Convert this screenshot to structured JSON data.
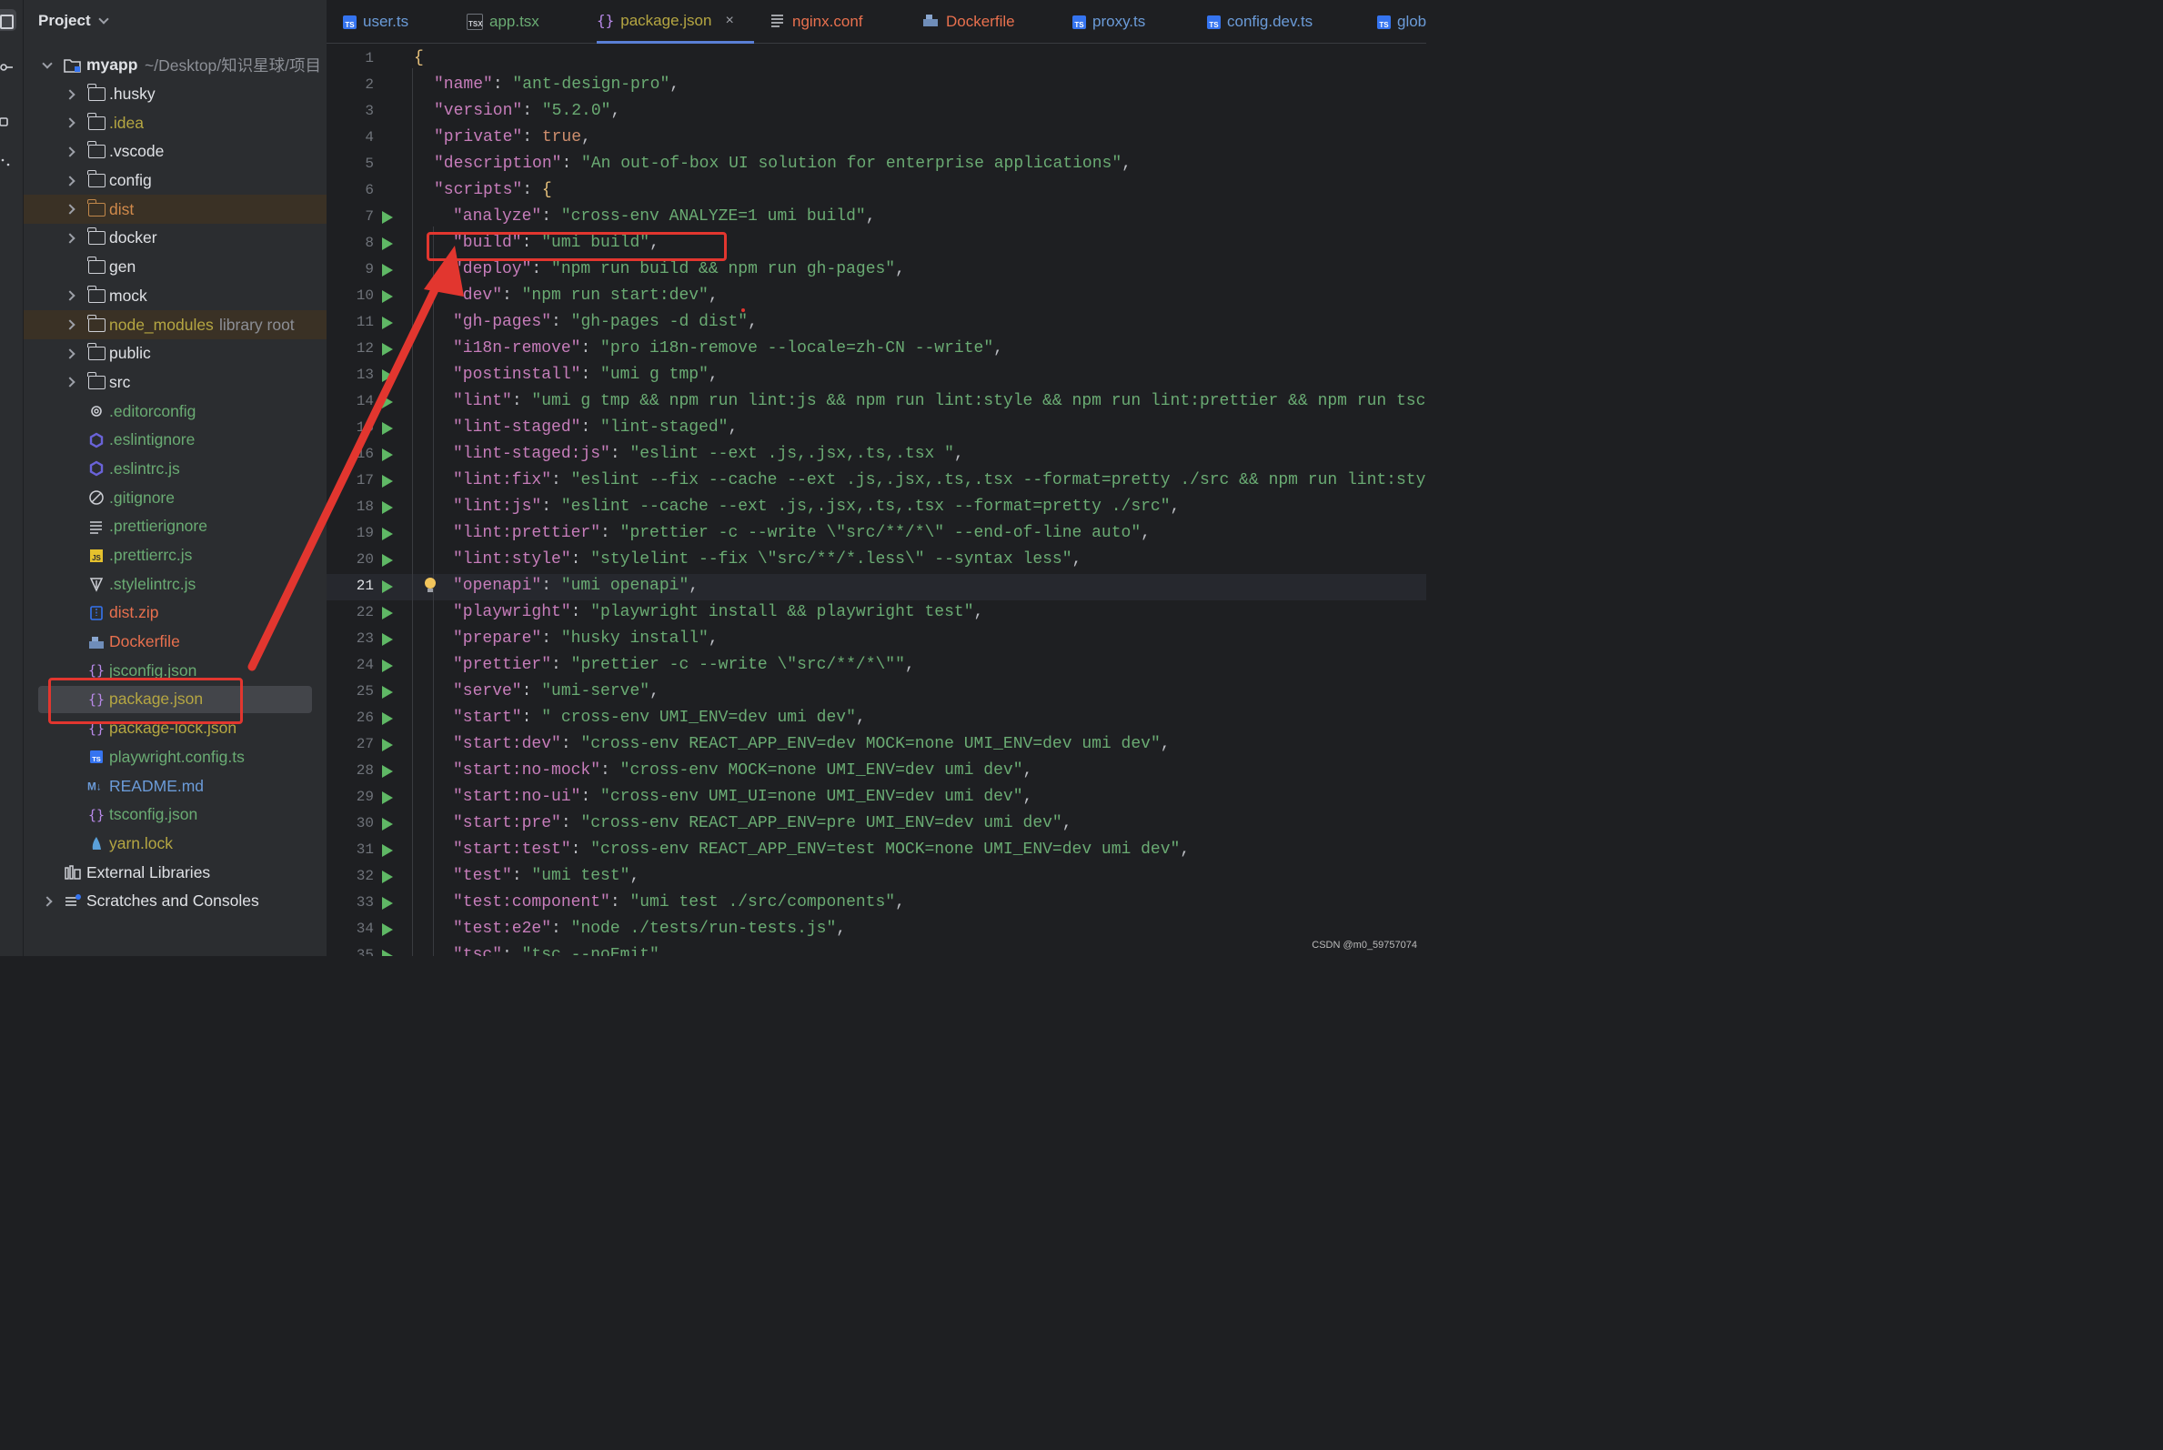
{
  "project_panel": {
    "title": "Project",
    "root": {
      "name": "myapp",
      "path": "~/Desktop/知识星球/项目"
    },
    "items": [
      {
        "name": ".husky",
        "kind": "folder",
        "expandable": true,
        "color": "default"
      },
      {
        "name": ".idea",
        "kind": "folder",
        "expandable": true,
        "color": "olive"
      },
      {
        "name": ".vscode",
        "kind": "folder",
        "expandable": true,
        "color": "default"
      },
      {
        "name": "config",
        "kind": "folder",
        "expandable": true,
        "color": "default"
      },
      {
        "name": "dist",
        "kind": "folder",
        "expandable": true,
        "color": "orange",
        "highlight": true
      },
      {
        "name": "docker",
        "kind": "folder",
        "expandable": true,
        "color": "default"
      },
      {
        "name": "gen",
        "kind": "folder",
        "expandable": false,
        "color": "default"
      },
      {
        "name": "mock",
        "kind": "folder",
        "expandable": true,
        "color": "default"
      },
      {
        "name": "node_modules",
        "kind": "folder",
        "expandable": true,
        "color": "olive",
        "highlight": true,
        "suffix": "library root"
      },
      {
        "name": "public",
        "kind": "folder",
        "expandable": true,
        "color": "default"
      },
      {
        "name": "src",
        "kind": "folder",
        "expandable": true,
        "color": "default"
      },
      {
        "name": ".editorconfig",
        "kind": "gear",
        "color": "green"
      },
      {
        "name": ".eslintignore",
        "kind": "eslint",
        "color": "green"
      },
      {
        "name": ".eslintrc.js",
        "kind": "eslint",
        "color": "green"
      },
      {
        "name": ".gitignore",
        "kind": "ignore",
        "color": "green"
      },
      {
        "name": ".prettierignore",
        "kind": "lines",
        "color": "green"
      },
      {
        "name": ".prettierrc.js",
        "kind": "js",
        "color": "green"
      },
      {
        "name": ".stylelintrc.js",
        "kind": "stylelint",
        "color": "green"
      },
      {
        "name": "dist.zip",
        "kind": "zip",
        "color": "red"
      },
      {
        "name": "Dockerfile",
        "kind": "docker",
        "color": "red"
      },
      {
        "name": "jsconfig.json",
        "kind": "json",
        "color": "green"
      },
      {
        "name": "package.json",
        "kind": "json",
        "color": "olive",
        "selected": true
      },
      {
        "name": "package-lock.json",
        "kind": "json",
        "color": "olive"
      },
      {
        "name": "playwright.config.ts",
        "kind": "ts",
        "color": "green"
      },
      {
        "name": "README.md",
        "kind": "md",
        "color": "blue"
      },
      {
        "name": "tsconfig.json",
        "kind": "json",
        "color": "green"
      },
      {
        "name": "yarn.lock",
        "kind": "yarn",
        "color": "olive"
      }
    ],
    "external_libraries": "External Libraries",
    "scratches": "Scratches and Consoles"
  },
  "tabs": [
    {
      "label": "user.ts",
      "icon": "ts",
      "color": "blue"
    },
    {
      "label": "app.tsx",
      "icon": "tsx",
      "color": "green"
    },
    {
      "label": "package.json",
      "icon": "json",
      "color": "olive",
      "active": true
    },
    {
      "label": "nginx.conf",
      "icon": "lines",
      "color": "red"
    },
    {
      "label": "Dockerfile",
      "icon": "docker",
      "color": "red"
    },
    {
      "label": "proxy.ts",
      "icon": "ts",
      "color": "blue"
    },
    {
      "label": "config.dev.ts",
      "icon": "ts",
      "color": "blue"
    },
    {
      "label": "glob",
      "icon": "ts",
      "color": "blue"
    }
  ],
  "tab_icons": {
    "ts": "TS",
    "tsx": "TSX",
    "json": "{}",
    "close": "×"
  },
  "editor": {
    "current_line": 21,
    "lines": [
      {
        "n": 1,
        "open": "{"
      },
      {
        "n": 2,
        "k": "\"name\"",
        "v": "\"ant-design-pro\"",
        "comma": ","
      },
      {
        "n": 3,
        "k": "\"version\"",
        "v": "\"5.2.0\"",
        "comma": ","
      },
      {
        "n": 4,
        "k": "\"private\"",
        "v": "true",
        "vkw": true,
        "comma": ","
      },
      {
        "n": 5,
        "k": "\"description\"",
        "v": "\"An out-of-box UI solution for enterprise applications\"",
        "comma": ","
      },
      {
        "n": 6,
        "k": "\"scripts\"",
        "v": "{",
        "vbrace": true,
        "comma": ""
      },
      {
        "n": 7,
        "k": "\"analyze\"",
        "v": "\"cross-env ANALYZE=1 umi build\"",
        "comma": ",",
        "run": true,
        "nested": true
      },
      {
        "n": 8,
        "k": "\"build\"",
        "v": "\"umi build\"",
        "comma": ",",
        "run": true,
        "nested": true
      },
      {
        "n": 9,
        "k": "\"deploy\"",
        "v": "\"npm run build && npm run gh-pages\"",
        "comma": ",",
        "run": true,
        "nested": true
      },
      {
        "n": 10,
        "k": "\"dev\"",
        "v": "\"npm run start:dev\"",
        "comma": ",",
        "run": true,
        "nested": true
      },
      {
        "n": 11,
        "k": "\"gh-pages\"",
        "v": "\"gh-pages -d dist\"",
        "comma": ",",
        "run": true,
        "nested": true
      },
      {
        "n": 12,
        "k": "\"i18n-remove\"",
        "v": "\"pro i18n-remove --locale=zh-CN --write\"",
        "comma": ",",
        "run": true,
        "nested": true
      },
      {
        "n": 13,
        "k": "\"postinstall\"",
        "v": "\"umi g tmp\"",
        "comma": ",",
        "run": true,
        "nested": true
      },
      {
        "n": 14,
        "k": "\"lint\"",
        "v": "\"umi g tmp && npm run lint:js && npm run lint:style && npm run lint:prettier && npm run tsc\"",
        "comma": ",",
        "run": true,
        "nested": true
      },
      {
        "n": 15,
        "k": "\"lint-staged\"",
        "v": "\"lint-staged\"",
        "comma": ",",
        "run": true,
        "nested": true
      },
      {
        "n": 16,
        "k": "\"lint-staged:js\"",
        "v": "\"eslint --ext .js,.jsx,.ts,.tsx \"",
        "comma": ",",
        "run": true,
        "nested": true
      },
      {
        "n": 17,
        "k": "\"lint:fix\"",
        "v": "\"eslint --fix --cache --ext .js,.jsx,.ts,.tsx --format=pretty ./src && npm run lint:style\"",
        "comma": ",",
        "run": true,
        "nested": true
      },
      {
        "n": 18,
        "k": "\"lint:js\"",
        "v": "\"eslint --cache --ext .js,.jsx,.ts,.tsx --format=pretty ./src\"",
        "comma": ",",
        "run": true,
        "nested": true
      },
      {
        "n": 19,
        "k": "\"lint:prettier\"",
        "v": "\"prettier -c --write \\\"src/**/*\\\" --end-of-line auto\"",
        "comma": ",",
        "run": true,
        "nested": true
      },
      {
        "n": 20,
        "k": "\"lint:style\"",
        "v": "\"stylelint --fix \\\"src/**/*.less\\\" --syntax less\"",
        "comma": ",",
        "run": true,
        "nested": true
      },
      {
        "n": 21,
        "k": "\"openapi\"",
        "v": "\"umi openapi\"",
        "comma": ",",
        "run": true,
        "nested": true
      },
      {
        "n": 22,
        "k": "\"playwright\"",
        "v": "\"playwright install && playwright test\"",
        "comma": ",",
        "run": true,
        "nested": true
      },
      {
        "n": 23,
        "k": "\"prepare\"",
        "v": "\"husky install\"",
        "comma": ",",
        "run": true,
        "nested": true
      },
      {
        "n": 24,
        "k": "\"prettier\"",
        "v": "\"prettier -c --write \\\"src/**/*\\\"\"",
        "comma": ",",
        "run": true,
        "nested": true
      },
      {
        "n": 25,
        "k": "\"serve\"",
        "v": "\"umi-serve\"",
        "comma": ",",
        "run": true,
        "nested": true
      },
      {
        "n": 26,
        "k": "\"start\"",
        "v": "\" cross-env UMI_ENV=dev umi dev\"",
        "comma": ",",
        "run": true,
        "nested": true
      },
      {
        "n": 27,
        "k": "\"start:dev\"",
        "v": "\"cross-env REACT_APP_ENV=dev MOCK=none UMI_ENV=dev umi dev\"",
        "comma": ",",
        "run": true,
        "nested": true
      },
      {
        "n": 28,
        "k": "\"start:no-mock\"",
        "v": "\"cross-env MOCK=none UMI_ENV=dev umi dev\"",
        "comma": ",",
        "run": true,
        "nested": true
      },
      {
        "n": 29,
        "k": "\"start:no-ui\"",
        "v": "\"cross-env UMI_UI=none UMI_ENV=dev umi dev\"",
        "comma": ",",
        "run": true,
        "nested": true
      },
      {
        "n": 30,
        "k": "\"start:pre\"",
        "v": "\"cross-env REACT_APP_ENV=pre UMI_ENV=dev umi dev\"",
        "comma": ",",
        "run": true,
        "nested": true
      },
      {
        "n": 31,
        "k": "\"start:test\"",
        "v": "\"cross-env REACT_APP_ENV=test MOCK=none UMI_ENV=dev umi dev\"",
        "comma": ",",
        "run": true,
        "nested": true
      },
      {
        "n": 32,
        "k": "\"test\"",
        "v": "\"umi test\"",
        "comma": ",",
        "run": true,
        "nested": true
      },
      {
        "n": 33,
        "k": "\"test:component\"",
        "v": "\"umi test ./src/components\"",
        "comma": ",",
        "run": true,
        "nested": true
      },
      {
        "n": 34,
        "k": "\"test:e2e\"",
        "v": "\"node ./tests/run-tests.js\"",
        "comma": ",",
        "run": true,
        "nested": true
      },
      {
        "n": 35,
        "k": "\"tsc\"",
        "v": "\"tsc --noEmit\"",
        "comma": "",
        "run": true,
        "nested": true
      }
    ]
  },
  "colors": {
    "accent_red": "#e2362f",
    "json_key": "#c77dbb",
    "json_string": "#6aab73",
    "keyword": "#cf8e6d",
    "run_green": "#5fb865"
  },
  "watermark": "CSDN @m0_59757074"
}
